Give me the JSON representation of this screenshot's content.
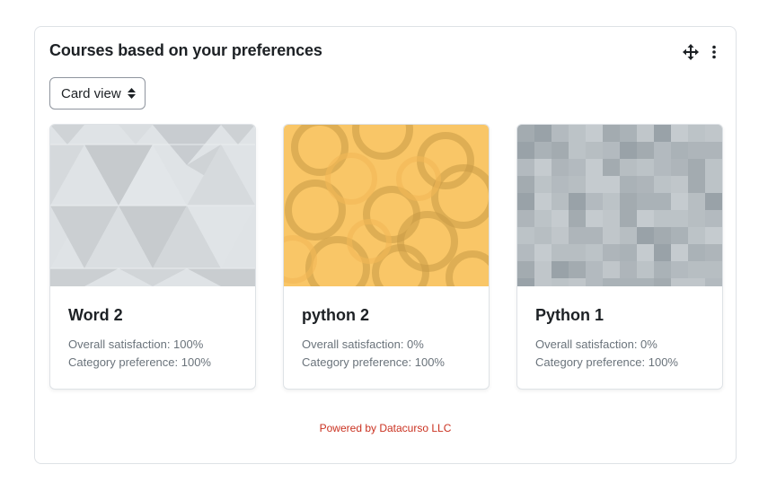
{
  "block": {
    "title": "Courses based on your preferences",
    "view_select": {
      "selected": "Card view"
    },
    "move_icon": "move-arrows-icon",
    "menu_icon": "kebab-menu-icon",
    "footer": "Powered by Datacurso LLC"
  },
  "cards": [
    {
      "title": "Word 2",
      "overall_satisfaction": "Overall satisfaction: 100%",
      "category_preference": "Category preference: 100%",
      "image_pattern": "grey-triangles"
    },
    {
      "title": "python 2",
      "overall_satisfaction": "Overall satisfaction: 0%",
      "category_preference": "Category preference: 100%",
      "image_pattern": "orange-circles"
    },
    {
      "title": "Python 1",
      "overall_satisfaction": "Overall satisfaction: 0%",
      "category_preference": "Category preference: 100%",
      "image_pattern": "grey-squares"
    }
  ],
  "colors": {
    "footer_link": "#ca3120",
    "border": "#dee2e6",
    "orange_pattern": "#f9c667"
  }
}
